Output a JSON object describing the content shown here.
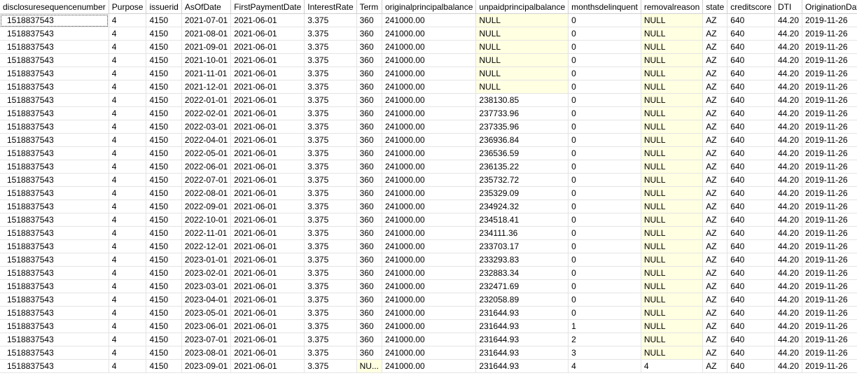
{
  "columns": [
    "disclosuresequencenumber",
    "Purpose",
    "issuerid",
    "AsOfDate",
    "FirstPaymentDate",
    "InterestRate",
    "Term",
    "originalprincipalbalance",
    "unpaidprincipalbalance",
    "monthsdelinquent",
    "removalreason",
    "state",
    "creditscore",
    "DTI",
    "OriginationDate"
  ],
  "null_text": "NULL",
  "null_truncated_text": "NU...",
  "rows": [
    [
      "1518837543",
      "4",
      "4150",
      "2021-07-01",
      "2021-06-01",
      "3.375",
      "360",
      "241000.00",
      "NULL",
      "0",
      "NULL",
      "AZ",
      "640",
      "44.20",
      "2019-11-26"
    ],
    [
      "1518837543",
      "4",
      "4150",
      "2021-08-01",
      "2021-06-01",
      "3.375",
      "360",
      "241000.00",
      "NULL",
      "0",
      "NULL",
      "AZ",
      "640",
      "44.20",
      "2019-11-26"
    ],
    [
      "1518837543",
      "4",
      "4150",
      "2021-09-01",
      "2021-06-01",
      "3.375",
      "360",
      "241000.00",
      "NULL",
      "0",
      "NULL",
      "AZ",
      "640",
      "44.20",
      "2019-11-26"
    ],
    [
      "1518837543",
      "4",
      "4150",
      "2021-10-01",
      "2021-06-01",
      "3.375",
      "360",
      "241000.00",
      "NULL",
      "0",
      "NULL",
      "AZ",
      "640",
      "44.20",
      "2019-11-26"
    ],
    [
      "1518837543",
      "4",
      "4150",
      "2021-11-01",
      "2021-06-01",
      "3.375",
      "360",
      "241000.00",
      "NULL",
      "0",
      "NULL",
      "AZ",
      "640",
      "44.20",
      "2019-11-26"
    ],
    [
      "1518837543",
      "4",
      "4150",
      "2021-12-01",
      "2021-06-01",
      "3.375",
      "360",
      "241000.00",
      "NULL",
      "0",
      "NULL",
      "AZ",
      "640",
      "44.20",
      "2019-11-26"
    ],
    [
      "1518837543",
      "4",
      "4150",
      "2022-01-01",
      "2021-06-01",
      "3.375",
      "360",
      "241000.00",
      "238130.85",
      "0",
      "NULL",
      "AZ",
      "640",
      "44.20",
      "2019-11-26"
    ],
    [
      "1518837543",
      "4",
      "4150",
      "2022-02-01",
      "2021-06-01",
      "3.375",
      "360",
      "241000.00",
      "237733.96",
      "0",
      "NULL",
      "AZ",
      "640",
      "44.20",
      "2019-11-26"
    ],
    [
      "1518837543",
      "4",
      "4150",
      "2022-03-01",
      "2021-06-01",
      "3.375",
      "360",
      "241000.00",
      "237335.96",
      "0",
      "NULL",
      "AZ",
      "640",
      "44.20",
      "2019-11-26"
    ],
    [
      "1518837543",
      "4",
      "4150",
      "2022-04-01",
      "2021-06-01",
      "3.375",
      "360",
      "241000.00",
      "236936.84",
      "0",
      "NULL",
      "AZ",
      "640",
      "44.20",
      "2019-11-26"
    ],
    [
      "1518837543",
      "4",
      "4150",
      "2022-05-01",
      "2021-06-01",
      "3.375",
      "360",
      "241000.00",
      "236536.59",
      "0",
      "NULL",
      "AZ",
      "640",
      "44.20",
      "2019-11-26"
    ],
    [
      "1518837543",
      "4",
      "4150",
      "2022-06-01",
      "2021-06-01",
      "3.375",
      "360",
      "241000.00",
      "236135.22",
      "0",
      "NULL",
      "AZ",
      "640",
      "44.20",
      "2019-11-26"
    ],
    [
      "1518837543",
      "4",
      "4150",
      "2022-07-01",
      "2021-06-01",
      "3.375",
      "360",
      "241000.00",
      "235732.72",
      "0",
      "NULL",
      "AZ",
      "640",
      "44.20",
      "2019-11-26"
    ],
    [
      "1518837543",
      "4",
      "4150",
      "2022-08-01",
      "2021-06-01",
      "3.375",
      "360",
      "241000.00",
      "235329.09",
      "0",
      "NULL",
      "AZ",
      "640",
      "44.20",
      "2019-11-26"
    ],
    [
      "1518837543",
      "4",
      "4150",
      "2022-09-01",
      "2021-06-01",
      "3.375",
      "360",
      "241000.00",
      "234924.32",
      "0",
      "NULL",
      "AZ",
      "640",
      "44.20",
      "2019-11-26"
    ],
    [
      "1518837543",
      "4",
      "4150",
      "2022-10-01",
      "2021-06-01",
      "3.375",
      "360",
      "241000.00",
      "234518.41",
      "0",
      "NULL",
      "AZ",
      "640",
      "44.20",
      "2019-11-26"
    ],
    [
      "1518837543",
      "4",
      "4150",
      "2022-11-01",
      "2021-06-01",
      "3.375",
      "360",
      "241000.00",
      "234111.36",
      "0",
      "NULL",
      "AZ",
      "640",
      "44.20",
      "2019-11-26"
    ],
    [
      "1518837543",
      "4",
      "4150",
      "2022-12-01",
      "2021-06-01",
      "3.375",
      "360",
      "241000.00",
      "233703.17",
      "0",
      "NULL",
      "AZ",
      "640",
      "44.20",
      "2019-11-26"
    ],
    [
      "1518837543",
      "4",
      "4150",
      "2023-01-01",
      "2021-06-01",
      "3.375",
      "360",
      "241000.00",
      "233293.83",
      "0",
      "NULL",
      "AZ",
      "640",
      "44.20",
      "2019-11-26"
    ],
    [
      "1518837543",
      "4",
      "4150",
      "2023-02-01",
      "2021-06-01",
      "3.375",
      "360",
      "241000.00",
      "232883.34",
      "0",
      "NULL",
      "AZ",
      "640",
      "44.20",
      "2019-11-26"
    ],
    [
      "1518837543",
      "4",
      "4150",
      "2023-03-01",
      "2021-06-01",
      "3.375",
      "360",
      "241000.00",
      "232471.69",
      "0",
      "NULL",
      "AZ",
      "640",
      "44.20",
      "2019-11-26"
    ],
    [
      "1518837543",
      "4",
      "4150",
      "2023-04-01",
      "2021-06-01",
      "3.375",
      "360",
      "241000.00",
      "232058.89",
      "0",
      "NULL",
      "AZ",
      "640",
      "44.20",
      "2019-11-26"
    ],
    [
      "1518837543",
      "4",
      "4150",
      "2023-05-01",
      "2021-06-01",
      "3.375",
      "360",
      "241000.00",
      "231644.93",
      "0",
      "NULL",
      "AZ",
      "640",
      "44.20",
      "2019-11-26"
    ],
    [
      "1518837543",
      "4",
      "4150",
      "2023-06-01",
      "2021-06-01",
      "3.375",
      "360",
      "241000.00",
      "231644.93",
      "1",
      "NULL",
      "AZ",
      "640",
      "44.20",
      "2019-11-26"
    ],
    [
      "1518837543",
      "4",
      "4150",
      "2023-07-01",
      "2021-06-01",
      "3.375",
      "360",
      "241000.00",
      "231644.93",
      "2",
      "NULL",
      "AZ",
      "640",
      "44.20",
      "2019-11-26"
    ],
    [
      "1518837543",
      "4",
      "4150",
      "2023-08-01",
      "2021-06-01",
      "3.375",
      "360",
      "241000.00",
      "231644.93",
      "3",
      "NULL",
      "AZ",
      "640",
      "44.20",
      "2019-11-26"
    ],
    [
      "1518837543",
      "4",
      "4150",
      "2023-09-01",
      "2021-06-01",
      "3.375",
      "NU...",
      "241000.00",
      "231644.93",
      "4",
      "4",
      "AZ",
      "640",
      "44.20",
      "2019-11-26"
    ]
  ],
  "selected_row": 0,
  "colors": {
    "null_background": "#ffffe1",
    "grid_line": "#e4e4e4",
    "header_line": "#d0d0d0"
  }
}
